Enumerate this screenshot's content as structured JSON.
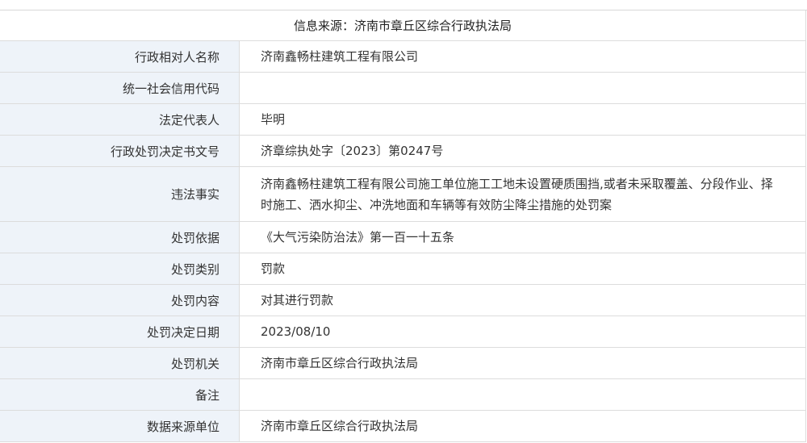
{
  "header": {
    "source_text": "信息来源：济南市章丘区综合行政执法局"
  },
  "rows": [
    {
      "label": "行政相对人名称",
      "value": "济南鑫畅柱建筑工程有限公司"
    },
    {
      "label": "统一社会信用代码",
      "value": ""
    },
    {
      "label": "法定代表人",
      "value": "毕明"
    },
    {
      "label": "行政处罚决定书文号",
      "value": "济章综执处字〔2023〕第0247号"
    },
    {
      "label": "违法事实",
      "value": "济南鑫畅柱建筑工程有限公司施工单位施工工地未设置硬质围挡,或者未采取覆盖、分段作业、择时施工、洒水抑尘、冲洗地面和车辆等有效防尘降尘措施的处罚案"
    },
    {
      "label": "处罚依据",
      "value": "《大气污染防治法》第一百一十五条"
    },
    {
      "label": "处罚类别",
      "value": "罚款"
    },
    {
      "label": "处罚内容",
      "value": "对其进行罚款"
    },
    {
      "label": "处罚决定日期",
      "value": "2023/08/10"
    },
    {
      "label": "处罚机关",
      "value": "济南市章丘区综合行政执法局"
    },
    {
      "label": "备注",
      "value": ""
    },
    {
      "label": "数据来源单位",
      "value": "济南市章丘区综合行政执法局"
    }
  ]
}
